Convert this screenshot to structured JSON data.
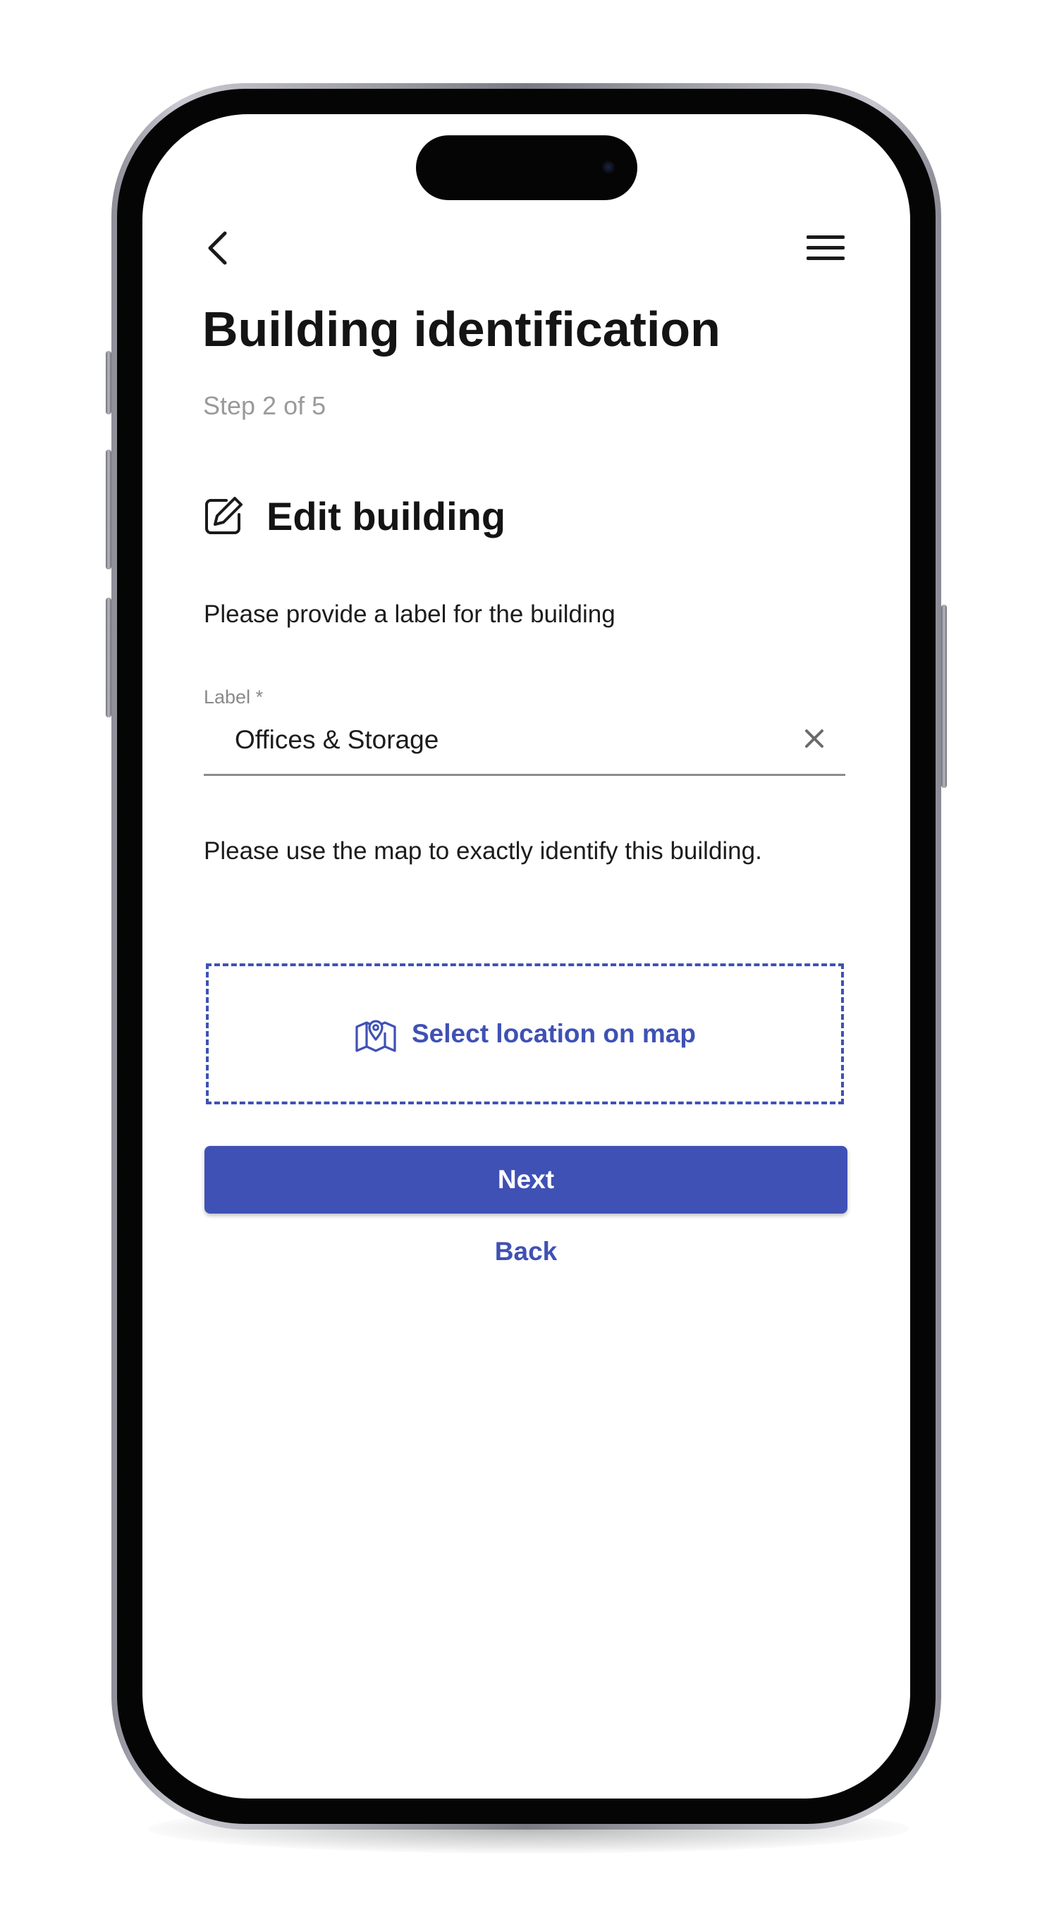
{
  "header": {
    "back_icon": "chevron-left-icon",
    "menu_icon": "hamburger-menu-icon"
  },
  "page": {
    "title": "Building identification",
    "step": "Step 2 of 5"
  },
  "section": {
    "icon": "edit-icon",
    "title": "Edit building"
  },
  "form": {
    "label_prompt": "Please provide a label for the building",
    "label_field": {
      "label": "Label *",
      "value": "Offices & Storage",
      "clear_icon": "close-icon"
    },
    "map_prompt": "Please use the map to exactly identify this building.",
    "map_button": {
      "icon": "map-pin-icon",
      "label": "Select location on map"
    }
  },
  "actions": {
    "next_label": "Next",
    "back_label": "Back"
  },
  "colors": {
    "primary": "#3f51b5",
    "text": "#141414",
    "muted": "#9a9a9a"
  }
}
